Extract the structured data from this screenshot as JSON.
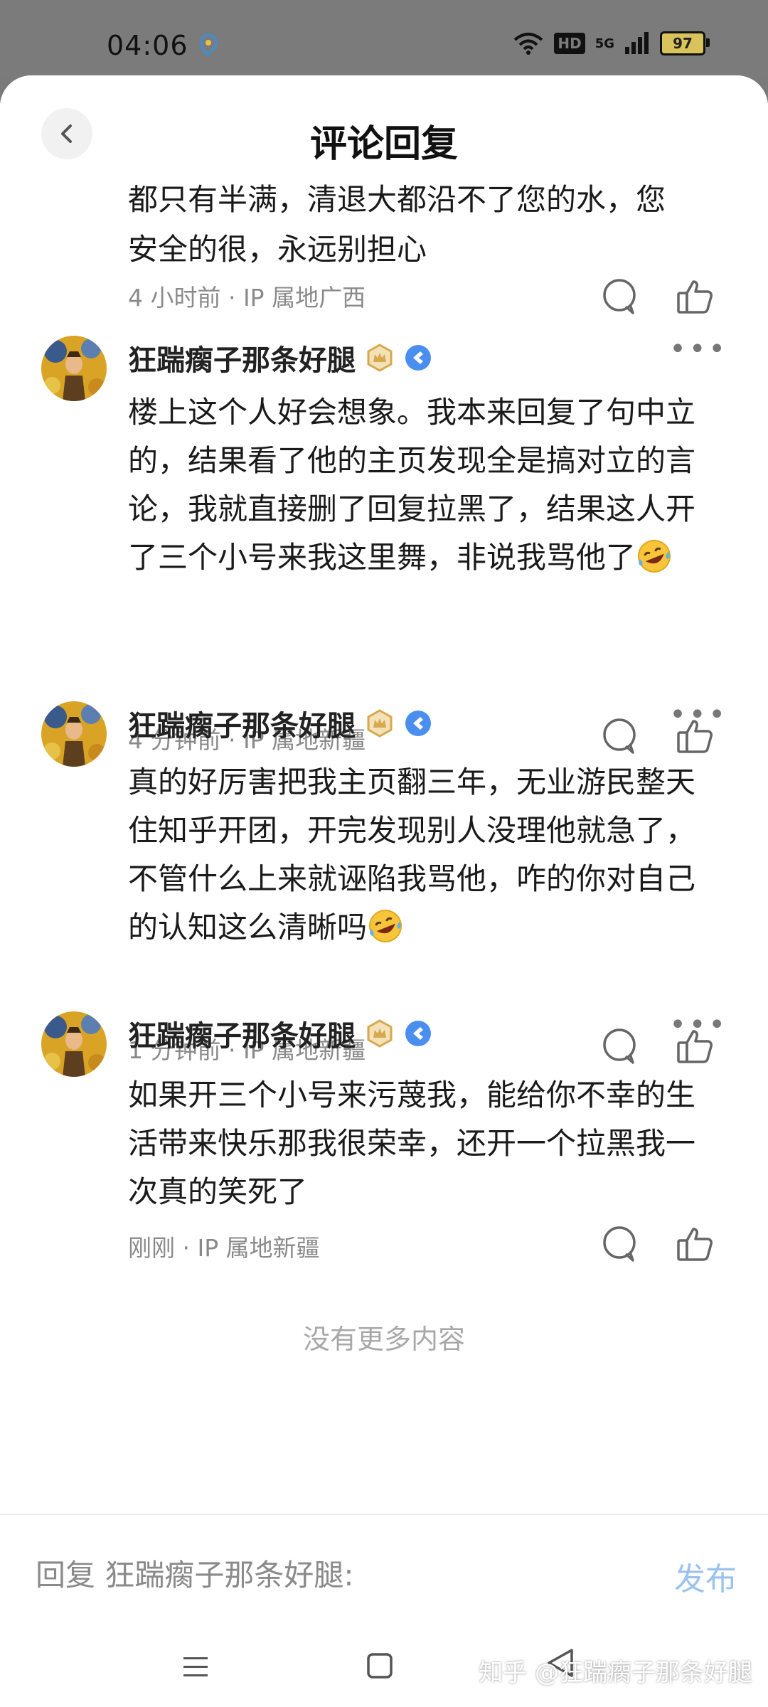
{
  "status_bar": {
    "time": "04:06",
    "hd": "HD",
    "network": "5G",
    "battery": "97"
  },
  "header": {
    "title": "评论回复"
  },
  "partial_comment": {
    "text_line1": "都只有半满，清退大都沿不了您的水，您",
    "text_line2": "安全的很，永远别担心",
    "meta": "4 小时前 · IP 属地广西"
  },
  "comments": [
    {
      "author": "狂踹瘸子那条好腿",
      "text": "楼上这个人好会想象。我本来回复了句中立的，结果看了他的主页发现全是搞对立的言论，我就直接删了回复拉黑了，结果这人开了三个小号来我这里舞，非说我骂他了",
      "meta": "4 分钟前 · IP 属地新疆",
      "emoji": "rofl"
    },
    {
      "author": "狂踹瘸子那条好腿",
      "text": "真的好厉害把我主页翻三年，无业游民整天住知乎开团，开完发现别人没理他就急了，不管什么上来就诬陷我骂他，咋的你对自己的认知这么清晰吗",
      "meta": "1 分钟前 · IP 属地新疆",
      "emoji": "rofl"
    },
    {
      "author": "狂踹瘸子那条好腿",
      "text": "如果开三个小号来污蔑我，能给你不幸的生活带来快乐那我很荣幸，还开一个拉黑我一次真的笑死了",
      "meta": "刚刚 · IP 属地新疆",
      "emoji": ""
    }
  ],
  "more_label": "•••",
  "no_more": "没有更多内容",
  "reply": {
    "placeholder": "回复 狂踹瘸子那条好腿:",
    "publish": "发布"
  },
  "watermark": "知乎 @狂踹瘸子那条好腿",
  "colors": {
    "accent_blue": "#9bc2ef",
    "meta_gray": "#8a8a8a",
    "badge_gold": "#e2b866",
    "badge_blue": "#4a8ff0"
  },
  "icons": [
    "back-icon",
    "reply-icon",
    "like-icon",
    "more-icon",
    "crown-badge-icon",
    "creator-badge-icon",
    "rofl-emoji-icon",
    "menu-icon",
    "home-icon",
    "back-nav-icon"
  ]
}
